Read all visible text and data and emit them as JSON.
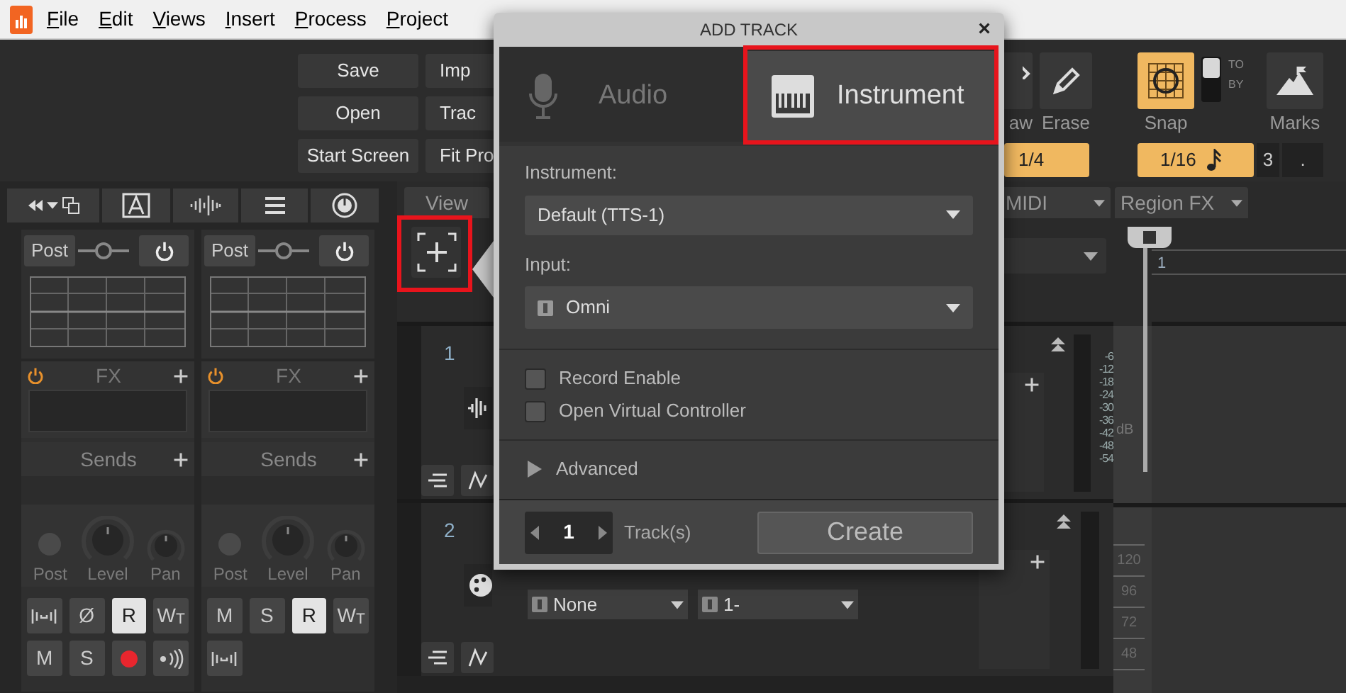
{
  "menu": [
    "File",
    "Edit",
    "Views",
    "Insert",
    "Process",
    "Project"
  ],
  "control_bar": {
    "file_buttons": [
      "Save",
      "Open",
      "Start Screen"
    ],
    "view_buttons": [
      "Imp",
      "Trac",
      "Fit Pro"
    ],
    "tools": [
      {
        "label": "aw",
        "kind": "draw"
      },
      {
        "label": "Erase",
        "kind": "erase"
      }
    ],
    "draw_resolution": "1/4",
    "snap": {
      "label": "Snap",
      "on": true,
      "to_mode": true,
      "to_label": "TO",
      "by_label": "BY",
      "resolution": "1/16",
      "triplet": "3",
      "dotted": "."
    },
    "marks_label": "Marks"
  },
  "inspector": {
    "strips": [
      {
        "post": "Post",
        "fx_on": true,
        "fx_label": "FX",
        "sends_label": "Sends",
        "knob_labels": [
          "Post",
          "Level",
          "Pan"
        ],
        "buttons": [
          {
            "kind": "meter",
            "on": false
          },
          {
            "kind": "text",
            "label": "Ø",
            "on": false
          },
          {
            "kind": "text",
            "label": "R",
            "on": true
          },
          {
            "kind": "text",
            "label": "W$_{T}$",
            "on": false
          },
          {
            "kind": "text",
            "label": "M",
            "on": false
          },
          {
            "kind": "text",
            "label": "S",
            "on": false
          },
          {
            "kind": "record",
            "on": true
          },
          {
            "kind": "echo",
            "on": false
          }
        ]
      },
      {
        "post": "Post",
        "fx_on": true,
        "fx_label": "FX",
        "sends_label": "Sends",
        "knob_labels": [
          "Post",
          "Level",
          "Pan"
        ],
        "buttons": [
          {
            "kind": "text",
            "label": "M",
            "on": false
          },
          {
            "kind": "text",
            "label": "S",
            "on": false
          },
          {
            "kind": "text",
            "label": "R",
            "on": true
          },
          {
            "kind": "text",
            "label": "W$_{T}$",
            "on": false
          },
          {
            "kind": "meter",
            "on": false
          }
        ]
      }
    ]
  },
  "track_view": {
    "menus": [
      {
        "label": "View",
        "kind": "tab"
      },
      {
        "label": "MIDI",
        "kind": "menu"
      },
      {
        "label": "Region FX",
        "kind": "menu"
      }
    ],
    "add_button": {
      "highlighted": true
    },
    "tracks": [
      {
        "number": "1",
        "kind": "audio"
      },
      {
        "number": "2",
        "kind": "instrument",
        "input": "None",
        "output": "1-"
      }
    ],
    "meter_scale": [
      "-6",
      "-12",
      "-18",
      "-24",
      "-30",
      "-36",
      "-42",
      "-48",
      "-54"
    ],
    "ruler_label": "dB",
    "tempo_labels": [
      "120",
      "96",
      "72",
      "48"
    ],
    "timeline_start": "1"
  },
  "dialog": {
    "title": "ADD TRACK",
    "close": "×",
    "tabs": [
      {
        "label": "Audio",
        "kind": "audio",
        "selected": false,
        "highlighted": false
      },
      {
        "label": "Instrument",
        "kind": "instrument",
        "selected": true,
        "highlighted": true
      }
    ],
    "instrument_label": "Instrument:",
    "instrument": "Default (TTS-1)",
    "input_label": "Input:",
    "input": "Omni",
    "options": [
      {
        "label": "Record Enable",
        "checked": false
      },
      {
        "label": "Open Virtual Controller",
        "checked": false
      }
    ],
    "advanced": {
      "label": "Advanced",
      "expanded": false
    },
    "count": "1",
    "count_label": "Track(s)",
    "create": "Create"
  }
}
